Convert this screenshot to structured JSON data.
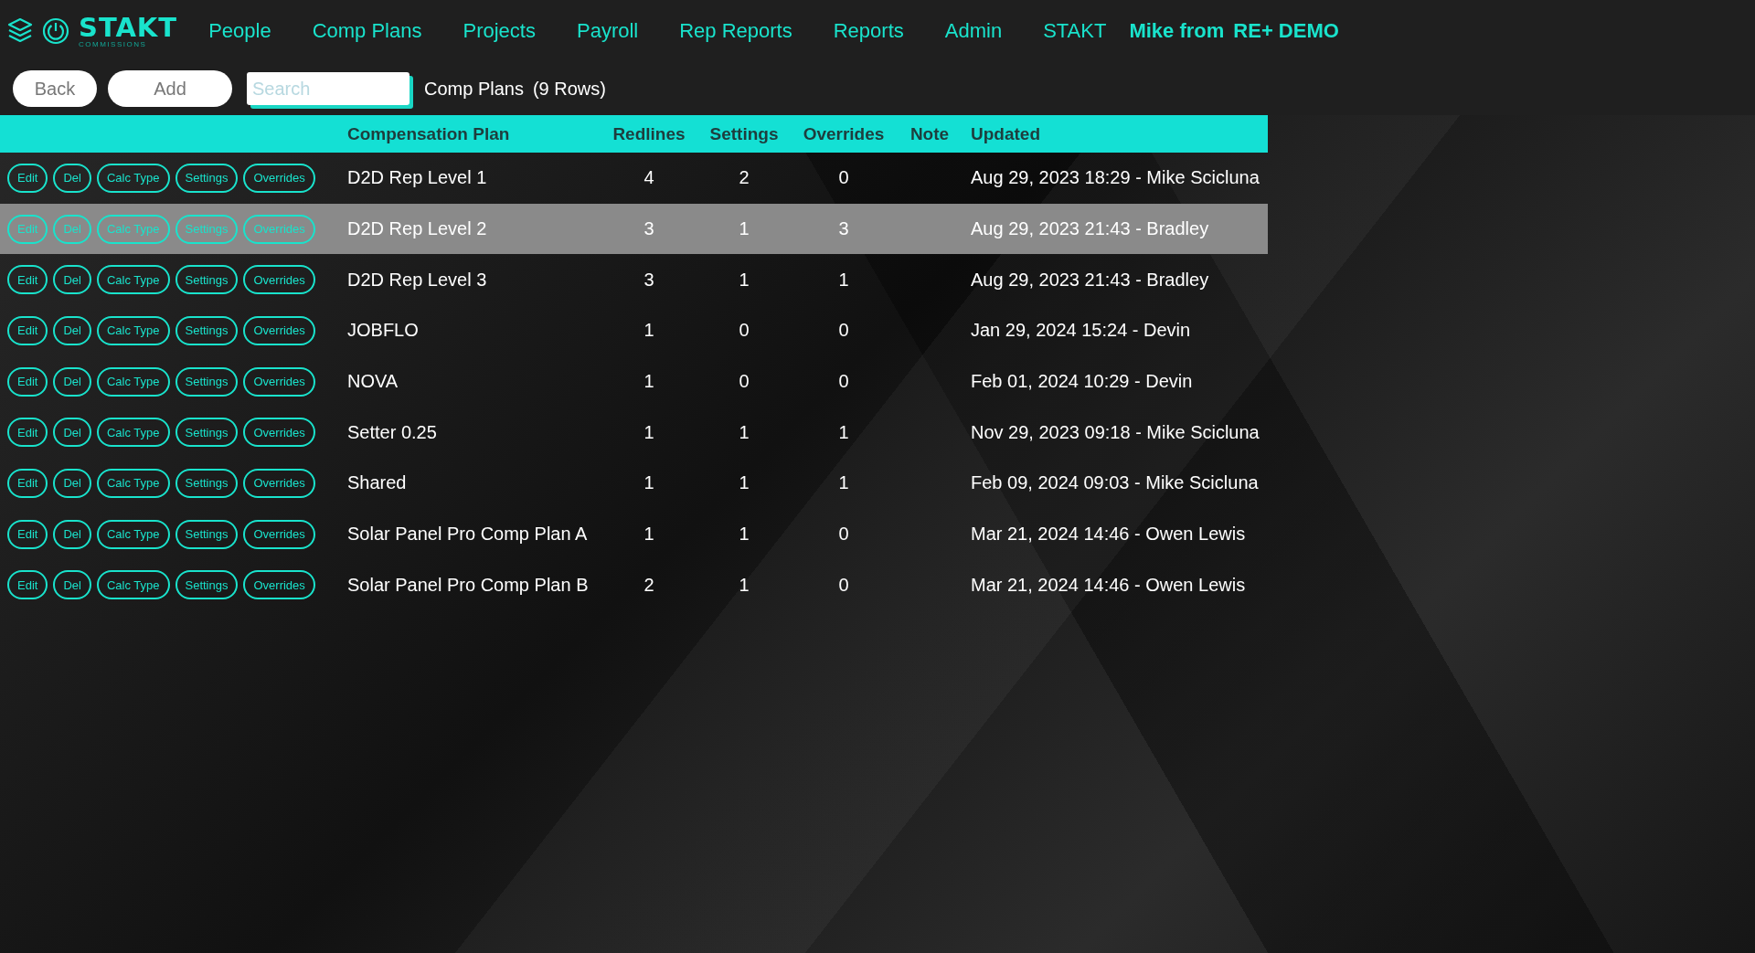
{
  "logo": {
    "name": "STAKT",
    "tagline": "COMMISSIONS"
  },
  "nav": [
    {
      "label": "People"
    },
    {
      "label": "Comp Plans"
    },
    {
      "label": "Projects"
    },
    {
      "label": "Payroll"
    },
    {
      "label": "Rep Reports"
    },
    {
      "label": "Reports"
    },
    {
      "label": "Admin"
    },
    {
      "label": "STAKT"
    }
  ],
  "user": {
    "name": "Mike from",
    "org": "RE+ DEMO"
  },
  "toolbar": {
    "buttons": [
      "Back",
      "Add"
    ],
    "search": {
      "placeholder": "Search"
    },
    "title": "Comp Plans",
    "count": "(9 Rows)"
  },
  "table": {
    "columns": [
      "Compensation Plan",
      "Redlines",
      "Settings",
      "Overrides",
      "Note",
      "Updated"
    ],
    "rows": [
      {
        "selected": false,
        "actions": [
          "Edit",
          "Del",
          "Calc Type",
          "Settings",
          "Overrides"
        ],
        "plan": "D2D Rep Level 1",
        "redlines": "4",
        "settings": "2",
        "overrides": "0",
        "updated": "Aug 29, 2023 18:29 - Mike Scicluna"
      },
      {
        "selected": true,
        "actions": [
          "Edit",
          "Del",
          "Calc Type",
          "Settings",
          "Overrides"
        ],
        "plan": "D2D Rep Level 2",
        "redlines": "3",
        "settings": "1",
        "overrides": "3",
        "updated": "Aug 29, 2023 21:43 - Bradley"
      },
      {
        "selected": false,
        "actions": [
          "Edit",
          "Del",
          "Calc Type",
          "Settings",
          "Overrides"
        ],
        "plan": "D2D Rep Level 3",
        "redlines": "3",
        "settings": "1",
        "overrides": "1",
        "updated": "Aug 29, 2023 21:43 - Bradley"
      },
      {
        "selected": false,
        "actions": [
          "Edit",
          "Del",
          "Calc Type",
          "Settings",
          "Overrides"
        ],
        "plan": "JOBFLO",
        "redlines": "1",
        "settings": "0",
        "overrides": "0",
        "updated": "Jan 29, 2024 15:24 - Devin"
      },
      {
        "selected": false,
        "actions": [
          "Edit",
          "Del",
          "Calc Type",
          "Settings",
          "Overrides"
        ],
        "plan": "NOVA",
        "redlines": "1",
        "settings": "0",
        "overrides": "0",
        "updated": "Feb 01, 2024 10:29 - Devin"
      },
      {
        "selected": false,
        "actions": [
          "Edit",
          "Del",
          "Calc Type",
          "Settings",
          "Overrides"
        ],
        "plan": "Setter 0.25",
        "redlines": "1",
        "settings": "1",
        "overrides": "1",
        "updated": "Nov 29, 2023 09:18 - Mike Scicluna"
      },
      {
        "selected": false,
        "actions": [
          "Edit",
          "Del",
          "Calc Type",
          "Settings",
          "Overrides"
        ],
        "plan": "Shared",
        "redlines": "1",
        "settings": "1",
        "overrides": "1",
        "updated": "Feb 09, 2024 09:03 - Mike Scicluna"
      },
      {
        "selected": false,
        "actions": [
          "Edit",
          "Del",
          "Calc Type",
          "Settings",
          "Overrides"
        ],
        "plan": "Solar Panel Pro Comp Plan A",
        "redlines": "1",
        "settings": "1",
        "overrides": "0",
        "updated": "Mar 21, 2024 14:46 - Owen Lewis"
      },
      {
        "selected": false,
        "actions": [
          "Edit",
          "Del",
          "Calc Type",
          "Settings",
          "Overrides"
        ],
        "plan": "Solar Panel Pro Comp Plan B",
        "redlines": "2",
        "settings": "1",
        "overrides": "0",
        "updated": "Mar 21, 2024 14:46 - Owen Lewis"
      }
    ]
  }
}
